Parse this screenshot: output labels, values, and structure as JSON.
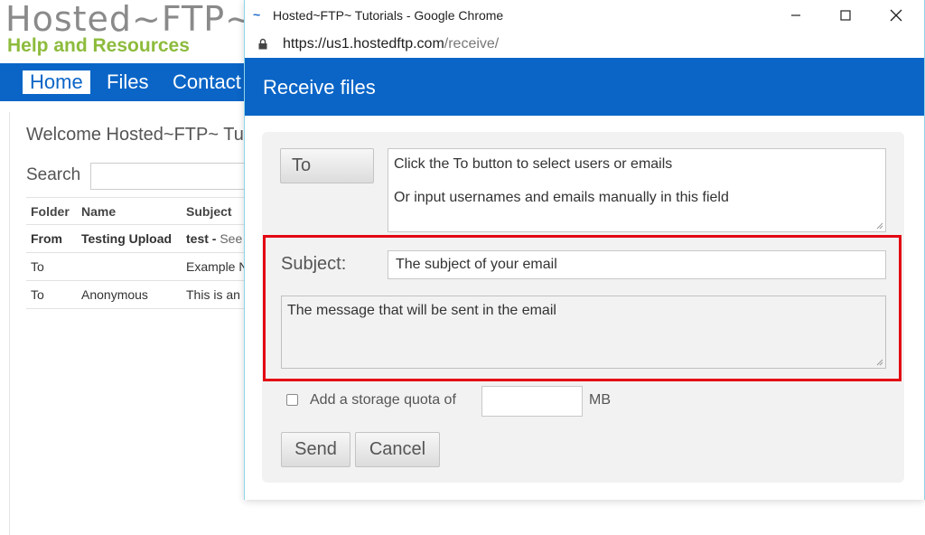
{
  "background_site": {
    "logo_line1": "Hosted~FTP~",
    "logo_line2": "Help and Resources",
    "nav": [
      "Home",
      "Files",
      "Contact"
    ],
    "welcome": "Welcome Hosted~FTP~ Tu",
    "search_label": "Search",
    "table": {
      "headers": [
        "Folder",
        "Name",
        "Subject"
      ],
      "rows": [
        {
          "folder": "From",
          "name": "Testing Upload",
          "subject": "test -",
          "subject_extra": "See"
        },
        {
          "folder": "To",
          "name": "",
          "subject": "Example N"
        },
        {
          "folder": "To",
          "name": "Anonymous",
          "subject": "This is an"
        }
      ]
    }
  },
  "browser": {
    "window_title": "Hosted~FTP~ Tutorials - Google Chrome",
    "url_host": "https://us1.hostedftp.com",
    "url_path": "/receive/",
    "favicon": "~"
  },
  "dialog": {
    "title": "Receive files",
    "to_button": "To",
    "to_placeholder_line1": "Click the To button to select users or emails",
    "to_placeholder_line2": "Or input usernames and emails manually in this field",
    "subject_label": "Subject:",
    "subject_placeholder": "The subject of your email",
    "message_placeholder": "The message that will be sent in the email",
    "quota_label": "Add a storage quota of",
    "quota_unit": "MB",
    "send_button": "Send",
    "cancel_button": "Cancel"
  },
  "colors": {
    "brand_blue": "#0a65c7",
    "highlight_red": "#e30613",
    "logo_green": "#8dbb3c"
  }
}
